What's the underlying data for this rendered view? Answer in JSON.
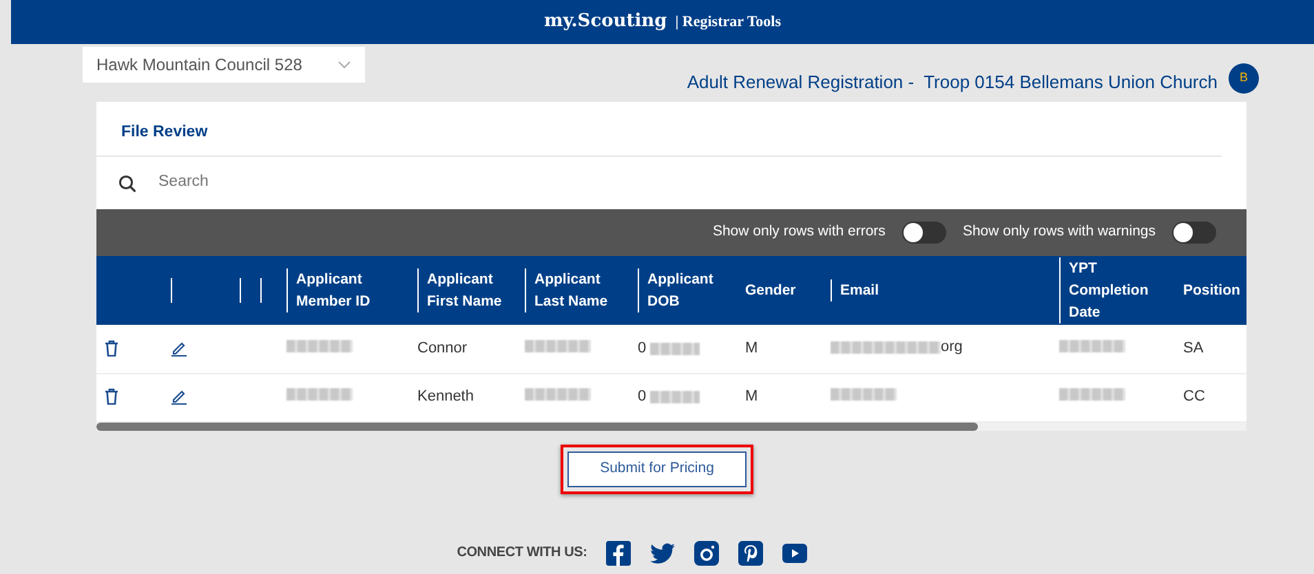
{
  "header": {
    "brand": "my.Scouting",
    "section": "| Registrar Tools"
  },
  "council_select": {
    "value": "Hawk Mountain Council 528"
  },
  "page_title": "Adult Renewal Registration -  Troop 0154 Bellemans Union Church",
  "avatar": "B",
  "card": {
    "title": "File Review",
    "search": {
      "placeholder": "Search"
    },
    "filters": [
      {
        "label": "Show only rows with errors",
        "on": false
      },
      {
        "label": "Show only rows with warnings",
        "on": false
      }
    ],
    "table": {
      "columns": [
        "",
        "",
        "",
        "Applicant Member ID",
        "Applicant First Name",
        "Applicant Last Name",
        "Applicant DOB",
        "Gender",
        "Email",
        "YPT Completion Date",
        "Position"
      ],
      "rows": [
        {
          "cells": [
            {
              "kind": "delete"
            },
            {
              "kind": "edit"
            },
            {
              "kind": "empty"
            },
            {
              "kind": "blur"
            },
            {
              "kind": "text",
              "text": "Connor"
            },
            {
              "kind": "blur"
            },
            {
              "kind": "blur",
              "prefix": "0"
            },
            {
              "kind": "text",
              "text": "M"
            },
            {
              "kind": "blur",
              "suffix": "org"
            },
            {
              "kind": "blur"
            },
            {
              "kind": "text",
              "text": "SA"
            }
          ]
        },
        {
          "cells": [
            {
              "kind": "delete"
            },
            {
              "kind": "edit"
            },
            {
              "kind": "empty"
            },
            {
              "kind": "blur"
            },
            {
              "kind": "text",
              "text": "Kenneth"
            },
            {
              "kind": "blur"
            },
            {
              "kind": "blur",
              "prefix": "0"
            },
            {
              "kind": "text",
              "text": "M"
            },
            {
              "kind": "blur"
            },
            {
              "kind": "blur"
            },
            {
              "kind": "text",
              "text": "CC"
            }
          ]
        }
      ]
    }
  },
  "submit_button": {
    "label": "Submit for Pricing",
    "highlighted": true
  },
  "footer": {
    "label": "CONNECT WITH US:",
    "social": [
      {
        "kind": "facebook"
      },
      {
        "kind": "twitter"
      },
      {
        "kind": "instagram"
      },
      {
        "kind": "pinterest"
      },
      {
        "kind": "youtube"
      }
    ]
  }
}
